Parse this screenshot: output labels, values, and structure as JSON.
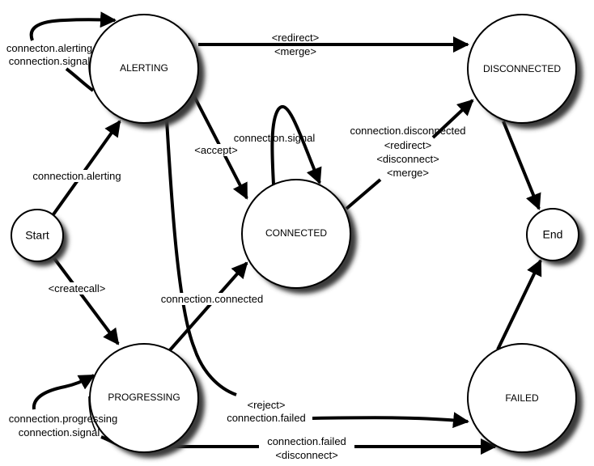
{
  "diagram": {
    "type": "state-machine",
    "nodes": [
      {
        "id": "alerting",
        "label": "ALERTING",
        "kind": "state"
      },
      {
        "id": "disconnected",
        "label": "DISCONNECTED",
        "kind": "state"
      },
      {
        "id": "connected",
        "label": "CONNECTED",
        "kind": "state"
      },
      {
        "id": "start",
        "label": "Start",
        "kind": "terminal"
      },
      {
        "id": "end",
        "label": "End",
        "kind": "terminal"
      },
      {
        "id": "progressing",
        "label": "PROGRESSING",
        "kind": "state"
      },
      {
        "id": "failed",
        "label": "FAILED",
        "kind": "state"
      }
    ],
    "edges": [
      {
        "id": "alerting-self",
        "from": "alerting",
        "to": "alerting",
        "labels": [
          "connecton.alerting",
          "connection.signal"
        ]
      },
      {
        "id": "alerting-disconnected",
        "from": "alerting",
        "to": "disconnected",
        "labels": [
          "<redirect>",
          "<merge>"
        ]
      },
      {
        "id": "alerting-connected",
        "from": "alerting",
        "to": "connected",
        "labels": [
          "<accept>"
        ]
      },
      {
        "id": "connected-self",
        "from": "connected",
        "to": "connected",
        "labels": [
          "connection.signal"
        ]
      },
      {
        "id": "connected-disconnected",
        "from": "connected",
        "to": "disconnected",
        "labels": [
          "connection.disconnected",
          "<redirect>",
          "<disconnect>",
          "<merge>"
        ]
      },
      {
        "id": "start-alerting",
        "from": "start",
        "to": "alerting",
        "labels": [
          "connection.alerting"
        ]
      },
      {
        "id": "start-progressing",
        "from": "start",
        "to": "progressing",
        "labels": [
          "<createcall>"
        ]
      },
      {
        "id": "progressing-connected",
        "from": "progressing",
        "to": "connected",
        "labels": [
          "connection.connected"
        ]
      },
      {
        "id": "alerting-failed",
        "from": "alerting",
        "to": "failed",
        "labels": [
          "<reject>",
          "connection.failed"
        ]
      },
      {
        "id": "progressing-self",
        "from": "progressing",
        "to": "progressing",
        "labels": [
          "connection.progressing",
          "connection.signal"
        ]
      },
      {
        "id": "progressing-failed",
        "from": "progressing",
        "to": "failed",
        "labels": [
          "connection.failed",
          "<disconnect>"
        ]
      },
      {
        "id": "disconnected-end",
        "from": "disconnected",
        "to": "end",
        "labels": []
      },
      {
        "id": "failed-end",
        "from": "failed",
        "to": "end",
        "labels": []
      }
    ]
  }
}
